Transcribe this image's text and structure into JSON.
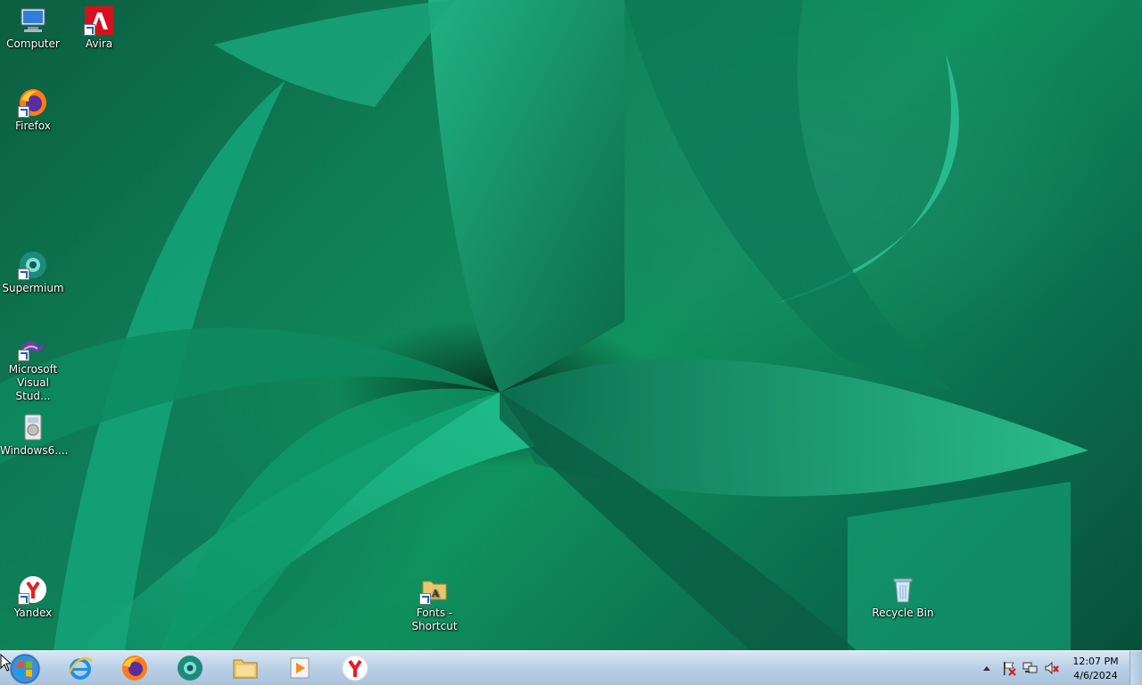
{
  "desktop": {
    "icons": [
      {
        "label": "Computer",
        "icon": "computer-icon"
      },
      {
        "label": "Avira",
        "icon": "avira-icon"
      },
      {
        "label": "Firefox",
        "icon": "firefox-icon"
      },
      {
        "label": "Supermium",
        "icon": "supermium-icon"
      },
      {
        "label": "Microsoft Visual Stud...",
        "icon": "visual-studio-icon"
      },
      {
        "label": "Windows6....",
        "icon": "installer-icon"
      },
      {
        "label": "Yandex",
        "icon": "yandex-icon"
      },
      {
        "label": "Fonts - Shortcut",
        "icon": "fonts-folder-icon"
      },
      {
        "label": "Recycle Bin",
        "icon": "recycle-bin-icon"
      }
    ]
  },
  "taskbar": {
    "start_icon": "windows-start-orb-icon",
    "pinned": [
      {
        "name": "Internet Explorer",
        "icon": "internet-explorer-icon"
      },
      {
        "name": "Firefox",
        "icon": "firefox-icon"
      },
      {
        "name": "Supermium",
        "icon": "supermium-icon"
      },
      {
        "name": "Windows Explorer",
        "icon": "folder-explorer-icon"
      },
      {
        "name": "Windows Media Player",
        "icon": "media-player-icon"
      },
      {
        "name": "Yandex",
        "icon": "yandex-icon"
      }
    ],
    "tray": {
      "icons": [
        "show-hidden-icons-arrow",
        "action-center-flag-icon",
        "network-icon",
        "volume-muted-icon"
      ],
      "time": "12:07 PM",
      "date": "4/6/2024"
    }
  },
  "colors": {
    "wallpaper_dark": "#08503a",
    "wallpaper_light": "#1aa57a",
    "taskbar": "#b9d0e6"
  }
}
